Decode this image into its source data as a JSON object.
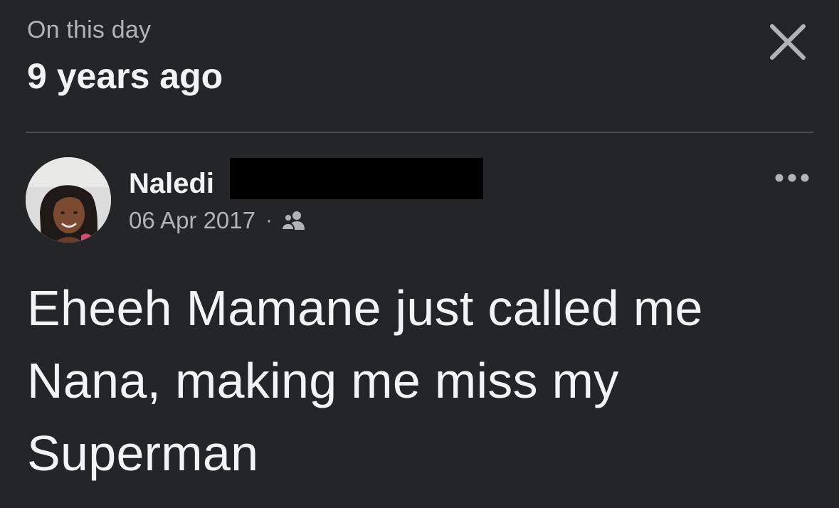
{
  "header": {
    "kicker": "On this day",
    "title": "9 years ago"
  },
  "post": {
    "author_name": "Naledi",
    "date": "06 Apr 2017",
    "separator": "·",
    "audience_icon": "friends-icon",
    "text": "Eheeh Mamane just called me Nana, making me miss my Superman"
  },
  "icons": {
    "close": "close-icon",
    "more": "more-options-icon",
    "avatar": "profile-photo"
  },
  "colors": {
    "background": "#242526",
    "primary_text": "#f2f3f5",
    "secondary_text": "#b0b3b8",
    "divider": "#4a4b4d",
    "redaction": "#000000"
  }
}
